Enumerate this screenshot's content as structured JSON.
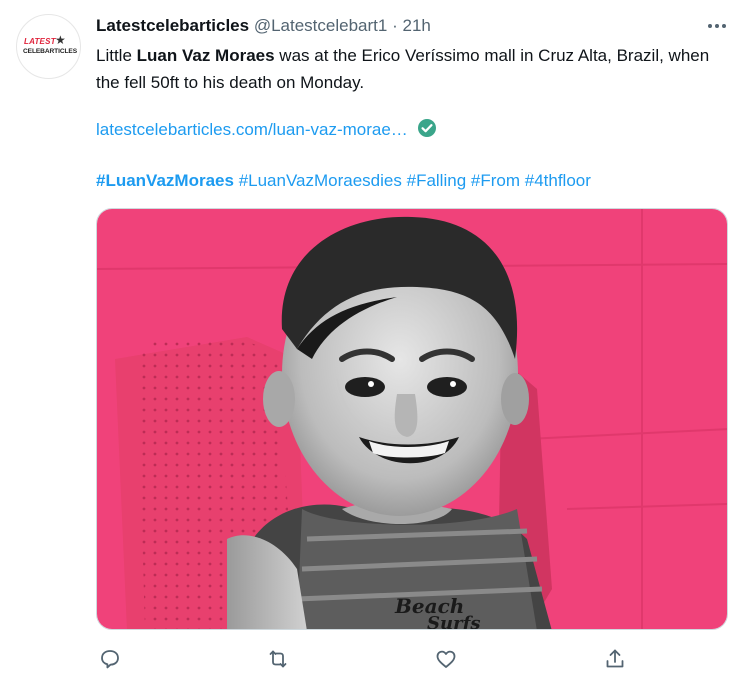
{
  "tweet": {
    "display_name": "Latestcelebarticles",
    "handle": "@Latestcelebart1",
    "separator": "·",
    "time": "21h",
    "avatar": {
      "logo_top": "LATEST",
      "logo_bottom": "CELEBARTICLES"
    },
    "text": {
      "part1": "Little ",
      "bold": "Luan Vaz Moraes",
      "part2": " was at the Erico Veríssimo mall in Cruz Alta, Brazil, when the fell 50ft to his death on Monday."
    },
    "link": "latestcelebarticles.com/luan-vaz-morae…",
    "hashtags": [
      "#LuanVazMoraes",
      "#LuanVazMoraesdies",
      "#Falling",
      "#From",
      "#4thfloor"
    ],
    "media": {
      "shirt_text_1": "Beach",
      "shirt_text_2": "Surfs"
    },
    "icons": {
      "more": "more-icon",
      "reply": "reply-icon",
      "retweet": "retweet-icon",
      "like": "like-icon",
      "share": "share-icon",
      "verified": "verified-check-icon"
    },
    "colors": {
      "link": "#1d9bf0",
      "background": "#f0427a",
      "verified": "#3aa58a"
    }
  }
}
